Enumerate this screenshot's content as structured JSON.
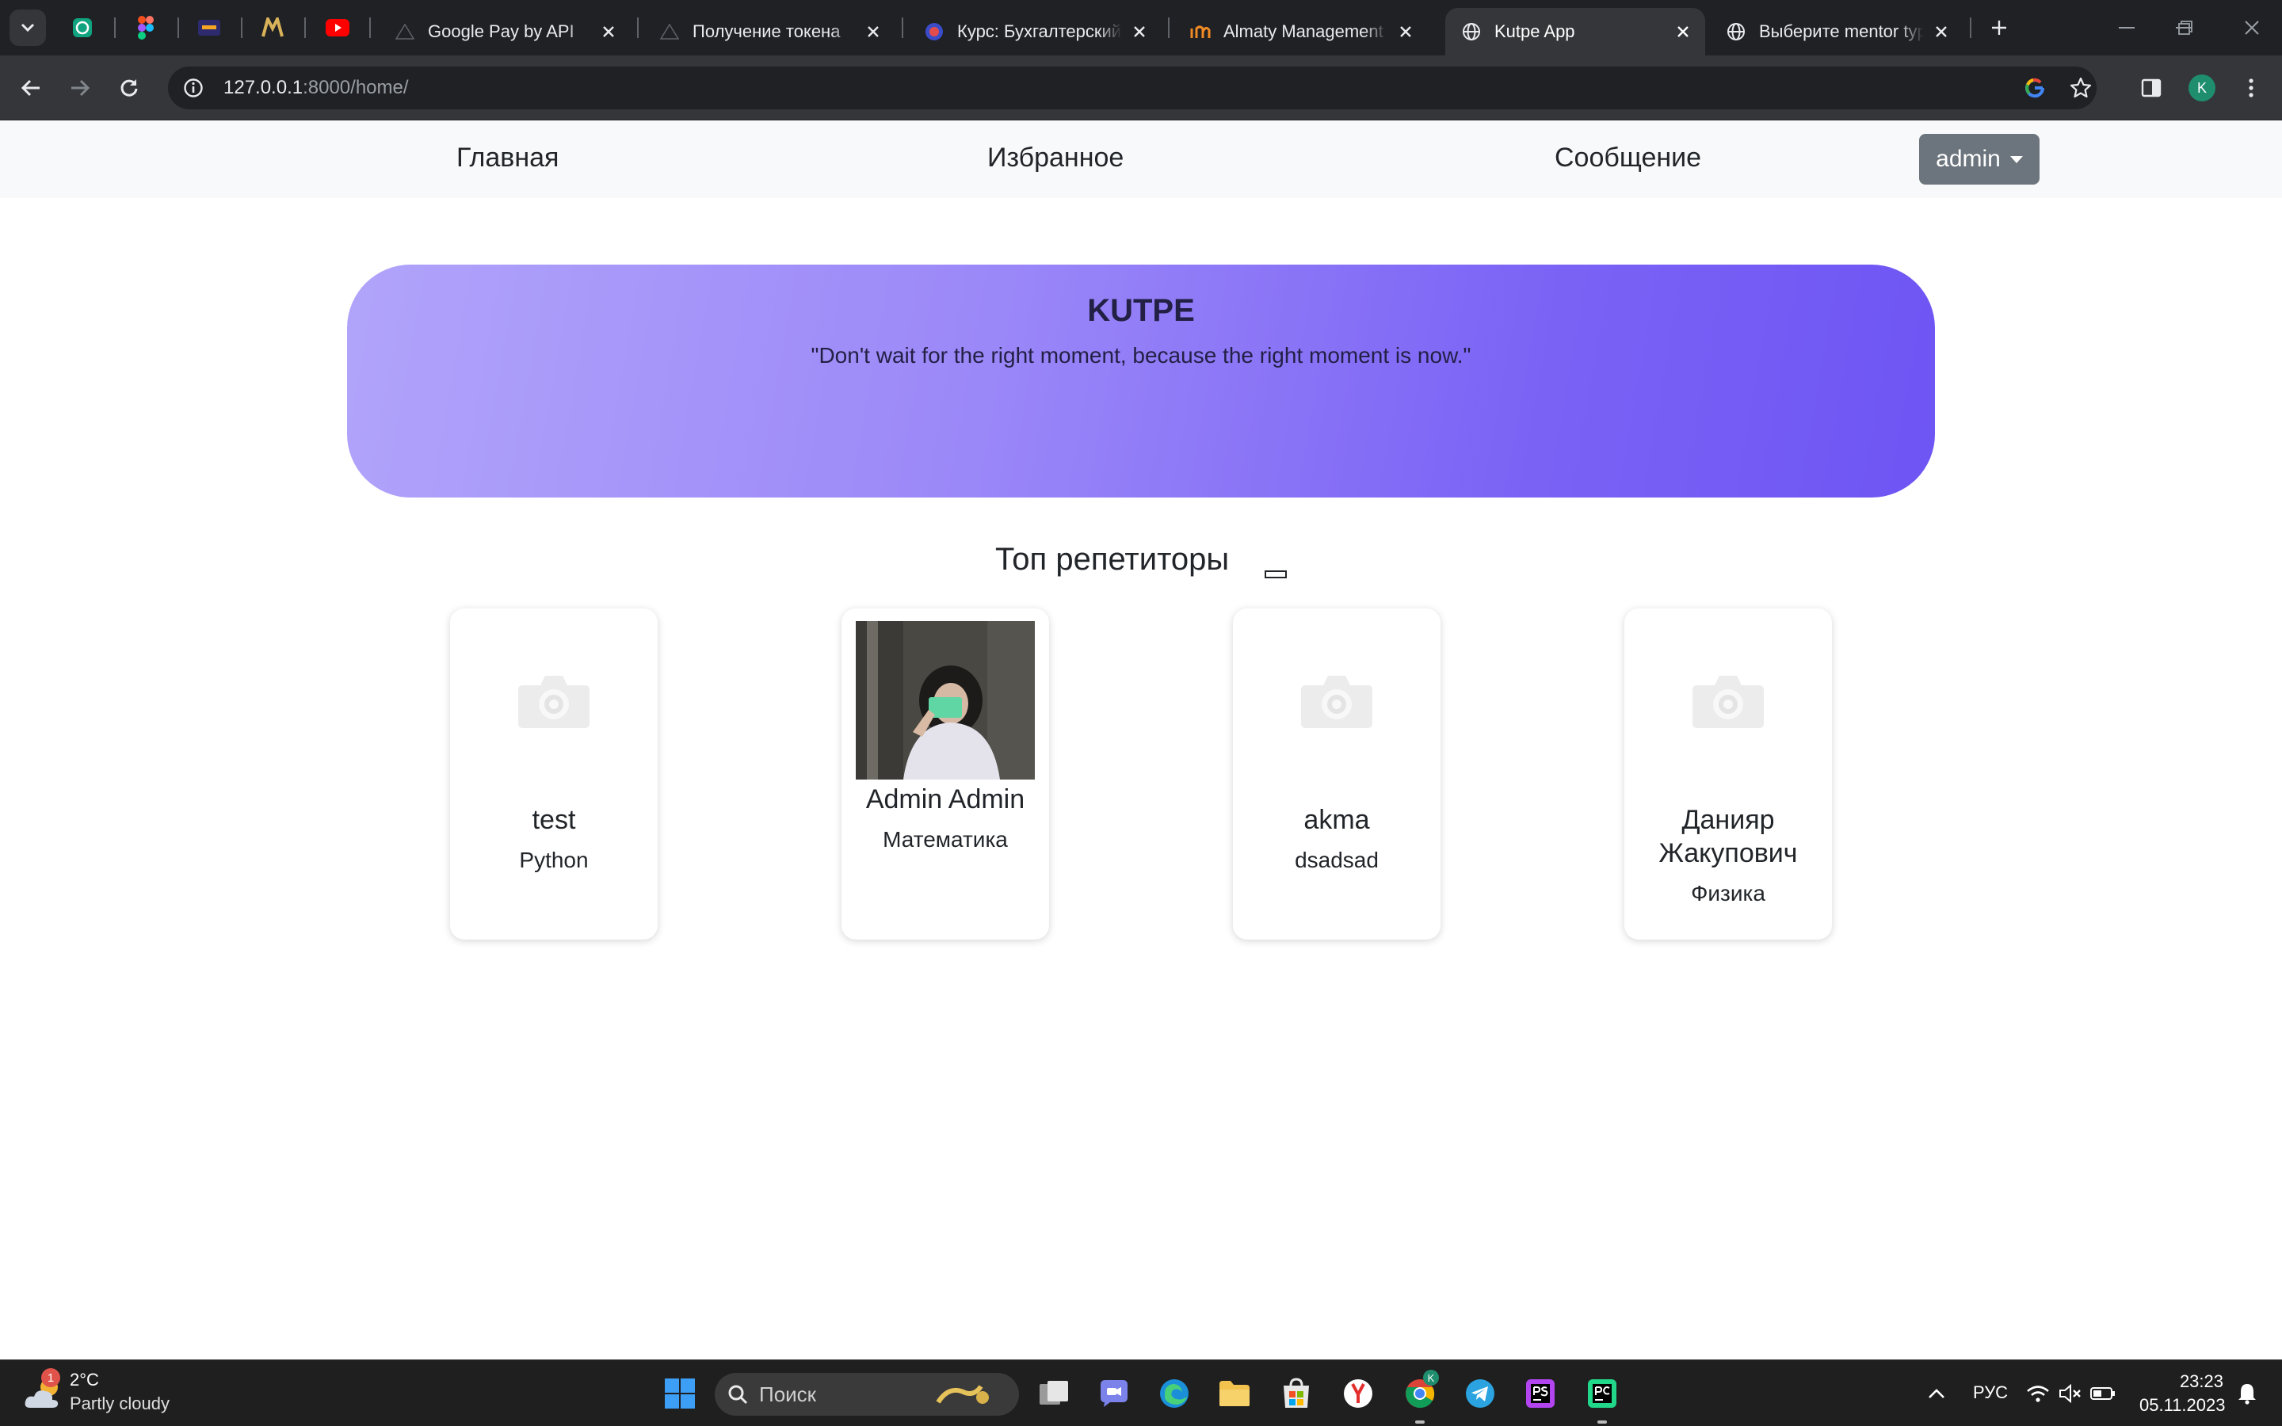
{
  "browser": {
    "tabs": [
      {
        "title": "Google Pay by API",
        "active": false
      },
      {
        "title": "Получение токена",
        "active": false
      },
      {
        "title": "Курс: Бухгалтерский учет",
        "active": false
      },
      {
        "title": "Almaty Management University",
        "active": false
      },
      {
        "title": "Kutpe App",
        "active": true
      },
      {
        "title": "Выберите mentor type",
        "active": false
      }
    ],
    "url_host": "127.0.0.1",
    "url_path": ":8000/home/",
    "profile_initial": "K"
  },
  "nav": {
    "home": "Главная",
    "favorites": "Избранное",
    "messages": "Сообщение",
    "user": "admin"
  },
  "hero": {
    "title": "KUTPE",
    "quote": "\"Don't wait for the right moment, because the right moment is now.\""
  },
  "section": {
    "title": "Топ репетиторы"
  },
  "tutors": [
    {
      "name": "test",
      "subject": "Python",
      "has_photo": false
    },
    {
      "name": "Admin Admin",
      "subject": "Математика",
      "has_photo": true
    },
    {
      "name": "akma",
      "subject": "dsadsad",
      "has_photo": false
    },
    {
      "name": "Данияр Жакупович",
      "subject": "Физика",
      "has_photo": false
    }
  ],
  "taskbar": {
    "weather_temp": "2°C",
    "weather_desc": "Partly cloudy",
    "weather_badge": "1",
    "search_placeholder": "Поиск",
    "language": "РУС",
    "time": "23:23",
    "date": "05.11.2023"
  },
  "colors": {
    "hero_gradient_start": "#b1a4fa",
    "hero_gradient_end": "#6e55f4",
    "navbar_bg": "#f8f9fa",
    "user_button_bg": "#6c757d"
  }
}
